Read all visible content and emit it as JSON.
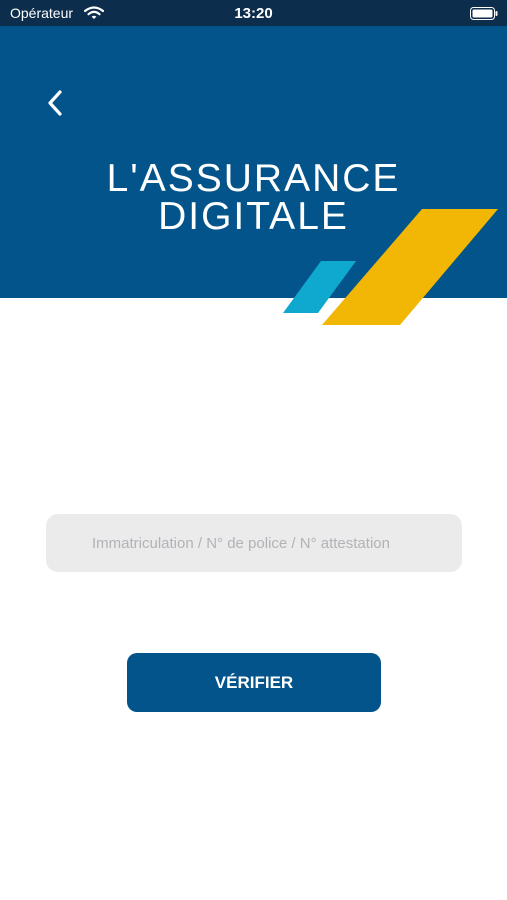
{
  "status_bar": {
    "carrier": "Opérateur",
    "time": "13:20",
    "icons": [
      "wifi-icon",
      "battery-icon"
    ]
  },
  "header": {
    "back_icon": "chevron-left-icon",
    "title_line1": "L'ASSURANCE",
    "title_line2": "DIGITALE"
  },
  "form": {
    "search_placeholder": "Immatriculation / N° de police / N° attestation",
    "search_value": "",
    "verify_label": "VÉRIFIER"
  },
  "colors": {
    "primary_blue": "#03548b",
    "status_bar": "#0d2d4d",
    "accent_yellow": "#f2b705",
    "accent_cyan": "#0fa8cf",
    "field_background": "#ebebeb"
  }
}
